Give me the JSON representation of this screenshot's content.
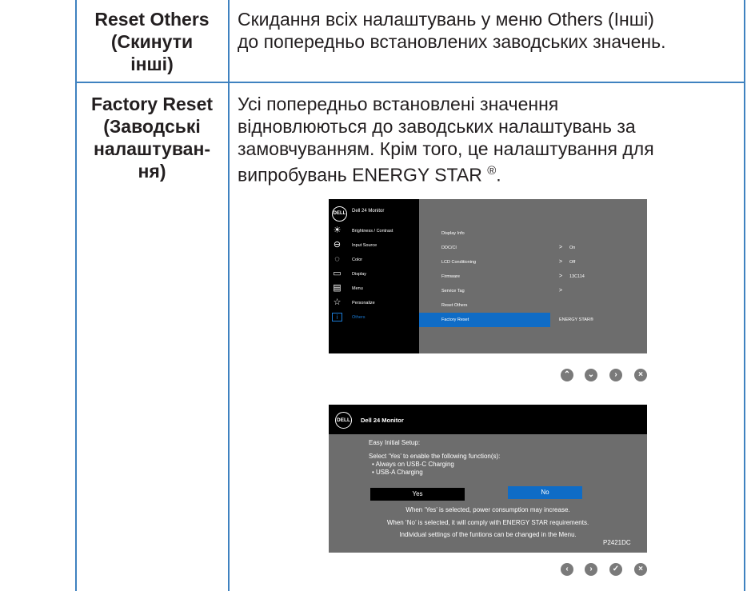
{
  "rows": [
    {
      "label_lines": [
        "Reset Others",
        "(Скинути",
        "інші)"
      ],
      "desc_lines": [
        "Скидання всіх налаштувань у меню Others (Інші)",
        "до попередньо встановлених заводських значень."
      ]
    },
    {
      "label_lines": [
        "Factory Reset",
        "(Заводські",
        "налаштуван-",
        "ня)"
      ],
      "desc_lines": [
        "Усі попередньо встановлені значення",
        "відновлюються до заводських налаштувань за",
        "замовчуванням. Крім того, це налаштування для",
        "випробувань ENERGY STAR"
      ],
      "registered_mark": "®",
      "desc_end": "."
    }
  ],
  "osd": {
    "logo": "DELL",
    "title": "Dell 24 Monitor",
    "menu": [
      {
        "icon": "brightness-icon",
        "glyph": "☀",
        "label": "Brightness / Contrast"
      },
      {
        "icon": "input-source-icon",
        "glyph": "⊖",
        "label": "Input Source"
      },
      {
        "icon": "color-icon",
        "glyph": "◌",
        "label": "Color"
      },
      {
        "icon": "display-icon",
        "glyph": "▭",
        "label": "Display"
      },
      {
        "icon": "menu-icon",
        "glyph": "▤",
        "label": "Menu"
      },
      {
        "icon": "personalize-icon",
        "glyph": "☆",
        "label": "Personalize"
      },
      {
        "icon": "others-icon",
        "glyph": "i",
        "label": "Others"
      }
    ],
    "items": [
      {
        "name": "Display Info",
        "arrow": "",
        "value": ""
      },
      {
        "name": "DDC/CI",
        "arrow": ">",
        "value": "On"
      },
      {
        "name": "LCD Conditioning",
        "arrow": ">",
        "value": "Off"
      },
      {
        "name": "Firmware",
        "arrow": ">",
        "value": "13C114"
      },
      {
        "name": "Service Tag",
        "arrow": ">",
        "value": ""
      },
      {
        "name": "Reset Others",
        "arrow": "",
        "value": ""
      },
      {
        "name": "Factory Reset",
        "arrow": "",
        "value": "ENERGY STAR®"
      }
    ],
    "nav": [
      "up-icon",
      "down-icon",
      "right-icon",
      "close-icon"
    ]
  },
  "dialog": {
    "logo": "DELL",
    "title": "Dell 24 Monitor",
    "setup": "Easy Initial Setup:",
    "select": "Select ‘Yes’ to enable the following function(s):",
    "bullet1": "• Always on USB-C Charging",
    "bullet2": "• USB-A Charging",
    "yes": "Yes",
    "no": "No",
    "note1": "When ‘Yes’ is selected, power consumption may increase.",
    "note2": "When ‘No’ is selected, it will comply with ENERGY STAR requirements.",
    "note3": "Individual settings of the funtions can be changed in the Menu.",
    "model": "P2421DC",
    "nav": [
      "left-icon",
      "right-icon",
      "check-icon",
      "close-icon"
    ]
  },
  "colors": {
    "rule": "#3f82c0",
    "osd_gray": "#6d6d6d",
    "highlight": "#0f6cc6",
    "nav_gray": "#7a7a7a"
  }
}
